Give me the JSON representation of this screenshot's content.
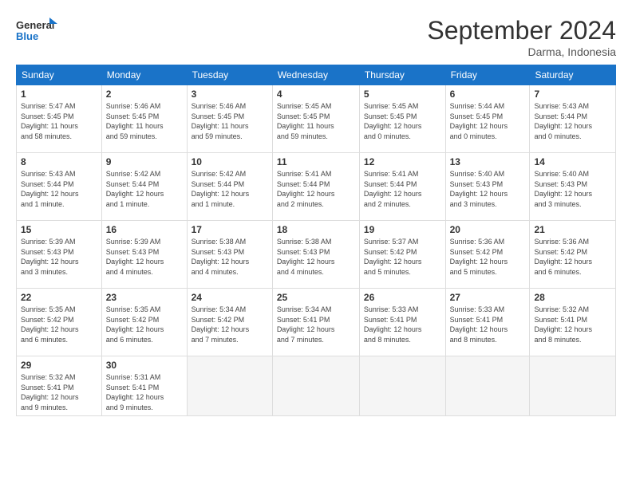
{
  "logo": {
    "line1": "General",
    "line2": "Blue"
  },
  "title": "September 2024",
  "subtitle": "Darma, Indonesia",
  "days_of_week": [
    "Sunday",
    "Monday",
    "Tuesday",
    "Wednesday",
    "Thursday",
    "Friday",
    "Saturday"
  ],
  "weeks": [
    [
      {
        "day": "1",
        "info": "Sunrise: 5:47 AM\nSunset: 5:45 PM\nDaylight: 11 hours\nand 58 minutes."
      },
      {
        "day": "2",
        "info": "Sunrise: 5:46 AM\nSunset: 5:45 PM\nDaylight: 11 hours\nand 59 minutes."
      },
      {
        "day": "3",
        "info": "Sunrise: 5:46 AM\nSunset: 5:45 PM\nDaylight: 11 hours\nand 59 minutes."
      },
      {
        "day": "4",
        "info": "Sunrise: 5:45 AM\nSunset: 5:45 PM\nDaylight: 11 hours\nand 59 minutes."
      },
      {
        "day": "5",
        "info": "Sunrise: 5:45 AM\nSunset: 5:45 PM\nDaylight: 12 hours\nand 0 minutes."
      },
      {
        "day": "6",
        "info": "Sunrise: 5:44 AM\nSunset: 5:45 PM\nDaylight: 12 hours\nand 0 minutes."
      },
      {
        "day": "7",
        "info": "Sunrise: 5:43 AM\nSunset: 5:44 PM\nDaylight: 12 hours\nand 0 minutes."
      }
    ],
    [
      {
        "day": "8",
        "info": "Sunrise: 5:43 AM\nSunset: 5:44 PM\nDaylight: 12 hours\nand 1 minute."
      },
      {
        "day": "9",
        "info": "Sunrise: 5:42 AM\nSunset: 5:44 PM\nDaylight: 12 hours\nand 1 minute."
      },
      {
        "day": "10",
        "info": "Sunrise: 5:42 AM\nSunset: 5:44 PM\nDaylight: 12 hours\nand 1 minute."
      },
      {
        "day": "11",
        "info": "Sunrise: 5:41 AM\nSunset: 5:44 PM\nDaylight: 12 hours\nand 2 minutes."
      },
      {
        "day": "12",
        "info": "Sunrise: 5:41 AM\nSunset: 5:44 PM\nDaylight: 12 hours\nand 2 minutes."
      },
      {
        "day": "13",
        "info": "Sunrise: 5:40 AM\nSunset: 5:43 PM\nDaylight: 12 hours\nand 3 minutes."
      },
      {
        "day": "14",
        "info": "Sunrise: 5:40 AM\nSunset: 5:43 PM\nDaylight: 12 hours\nand 3 minutes."
      }
    ],
    [
      {
        "day": "15",
        "info": "Sunrise: 5:39 AM\nSunset: 5:43 PM\nDaylight: 12 hours\nand 3 minutes."
      },
      {
        "day": "16",
        "info": "Sunrise: 5:39 AM\nSunset: 5:43 PM\nDaylight: 12 hours\nand 4 minutes."
      },
      {
        "day": "17",
        "info": "Sunrise: 5:38 AM\nSunset: 5:43 PM\nDaylight: 12 hours\nand 4 minutes."
      },
      {
        "day": "18",
        "info": "Sunrise: 5:38 AM\nSunset: 5:43 PM\nDaylight: 12 hours\nand 4 minutes."
      },
      {
        "day": "19",
        "info": "Sunrise: 5:37 AM\nSunset: 5:42 PM\nDaylight: 12 hours\nand 5 minutes."
      },
      {
        "day": "20",
        "info": "Sunrise: 5:36 AM\nSunset: 5:42 PM\nDaylight: 12 hours\nand 5 minutes."
      },
      {
        "day": "21",
        "info": "Sunrise: 5:36 AM\nSunset: 5:42 PM\nDaylight: 12 hours\nand 6 minutes."
      }
    ],
    [
      {
        "day": "22",
        "info": "Sunrise: 5:35 AM\nSunset: 5:42 PM\nDaylight: 12 hours\nand 6 minutes."
      },
      {
        "day": "23",
        "info": "Sunrise: 5:35 AM\nSunset: 5:42 PM\nDaylight: 12 hours\nand 6 minutes."
      },
      {
        "day": "24",
        "info": "Sunrise: 5:34 AM\nSunset: 5:42 PM\nDaylight: 12 hours\nand 7 minutes."
      },
      {
        "day": "25",
        "info": "Sunrise: 5:34 AM\nSunset: 5:41 PM\nDaylight: 12 hours\nand 7 minutes."
      },
      {
        "day": "26",
        "info": "Sunrise: 5:33 AM\nSunset: 5:41 PM\nDaylight: 12 hours\nand 8 minutes."
      },
      {
        "day": "27",
        "info": "Sunrise: 5:33 AM\nSunset: 5:41 PM\nDaylight: 12 hours\nand 8 minutes."
      },
      {
        "day": "28",
        "info": "Sunrise: 5:32 AM\nSunset: 5:41 PM\nDaylight: 12 hours\nand 8 minutes."
      }
    ],
    [
      {
        "day": "29",
        "info": "Sunrise: 5:32 AM\nSunset: 5:41 PM\nDaylight: 12 hours\nand 9 minutes."
      },
      {
        "day": "30",
        "info": "Sunrise: 5:31 AM\nSunset: 5:41 PM\nDaylight: 12 hours\nand 9 minutes."
      },
      {
        "day": "",
        "info": ""
      },
      {
        "day": "",
        "info": ""
      },
      {
        "day": "",
        "info": ""
      },
      {
        "day": "",
        "info": ""
      },
      {
        "day": "",
        "info": ""
      }
    ]
  ]
}
